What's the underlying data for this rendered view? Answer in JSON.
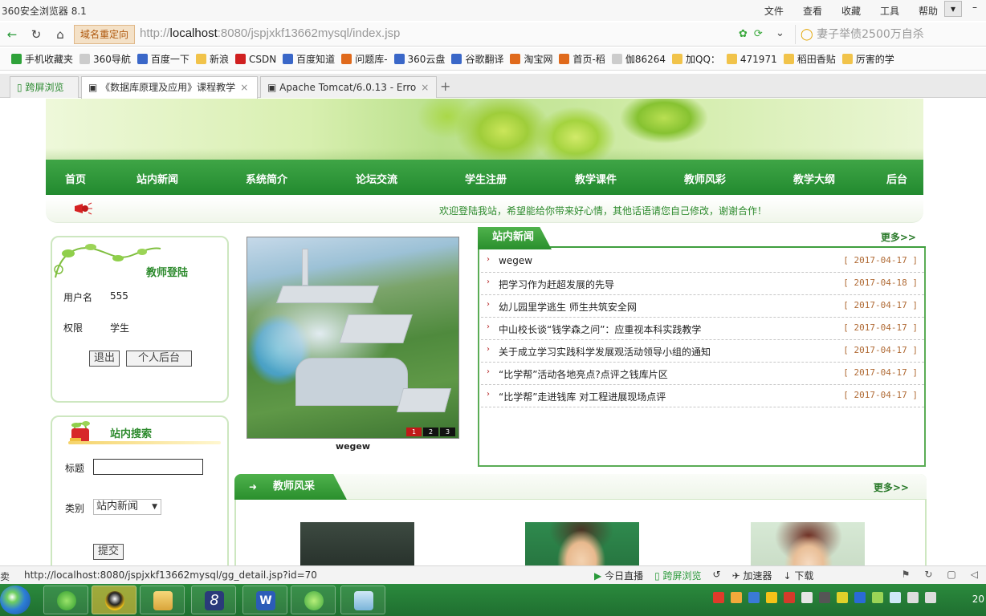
{
  "browser": {
    "title": "360安全浏览器 8.1",
    "menu": [
      "文件",
      "查看",
      "收藏",
      "工具",
      "帮助"
    ],
    "redirect_label": "域名重定向",
    "url_prefix": "http://",
    "url_host": "localhost",
    "url_rest": ":8080/jspjxkf13662mysql/index.jsp",
    "search_text": "妻子举债2500万自杀",
    "bookmarks": [
      "手机收藏夹",
      "360导航",
      "百度一下",
      "新浪",
      "CSDN",
      "百度知道",
      "问题库-",
      "360云盘",
      "谷歌翻译",
      "淘宝网",
      "首页-稻",
      "伽86264",
      "加QQ：",
      "471971",
      "稻田香贴",
      "厉害的学"
    ],
    "tabs": [
      {
        "label": "跨屏浏览"
      },
      {
        "label": "《数据库原理及应用》课程教学"
      },
      {
        "label": "Apache Tomcat/6.0.13 - Erro"
      }
    ]
  },
  "site": {
    "nav": [
      "首页",
      "站内新闻",
      "系统简介",
      "论坛交流",
      "学生注册",
      "教学课件",
      "教师风彩",
      "教学大纲",
      "后台"
    ],
    "notice": "欢迎登陆我站，希望能给你带来好心情，其他话语请您自己修改，谢谢合作！",
    "login": {
      "title": "教师登陆",
      "username_label": "用户名",
      "username_value": "555",
      "role_label": "权限",
      "role_value": "学生",
      "logout_btn": "退出",
      "backend_btn": "个人后台"
    },
    "search": {
      "title": "站内搜索",
      "title_label": "标题",
      "title_value": "",
      "type_label": "类别",
      "type_value": "站内新闻",
      "submit_btn": "提交"
    },
    "slideshow": {
      "caption": "wegew",
      "pages": [
        "1",
        "2",
        "3"
      ],
      "active_page": "1"
    },
    "news": {
      "title": "站内新闻",
      "more": "更多>>",
      "items": [
        {
          "title": "wegew",
          "date": "[ 2017-04-17 ]"
        },
        {
          "title": "把学习作为赶超发展的先导",
          "date": "[ 2017-04-18 ]"
        },
        {
          "title": "幼儿园里学逃生  师生共筑安全网",
          "date": "[ 2017-04-17 ]"
        },
        {
          "title": "中山校长谈“钱学森之问”：应重视本科实践教学",
          "date": "[ 2017-04-17 ]"
        },
        {
          "title": "关于成立学习实践科学发展观活动领导小组的通知",
          "date": "[ 2017-04-17 ]"
        },
        {
          "title": "“比学帮”活动各地亮点?点评之钱库片区",
          "date": "[ 2017-04-17 ]"
        },
        {
          "title": "“比学帮”走进钱库  对工程进展现场点评",
          "date": "[ 2017-04-17 ]"
        }
      ]
    },
    "teachers": {
      "title": "教师风采",
      "more": "更多>>"
    }
  },
  "statusbar": {
    "left": "卖",
    "link": "http://localhost:8080/jspjxkf13662mysql/gg_detail.jsp?id=70",
    "items": [
      "今日直播",
      "跨屏浏览",
      "加速器",
      "下载"
    ]
  },
  "taskbar": {
    "clock": "20"
  },
  "colors": {
    "nav_green": "#228a2f",
    "accent_green": "#2e8b2e",
    "date_color": "#b06a34",
    "bullet_red": "#b52323"
  }
}
